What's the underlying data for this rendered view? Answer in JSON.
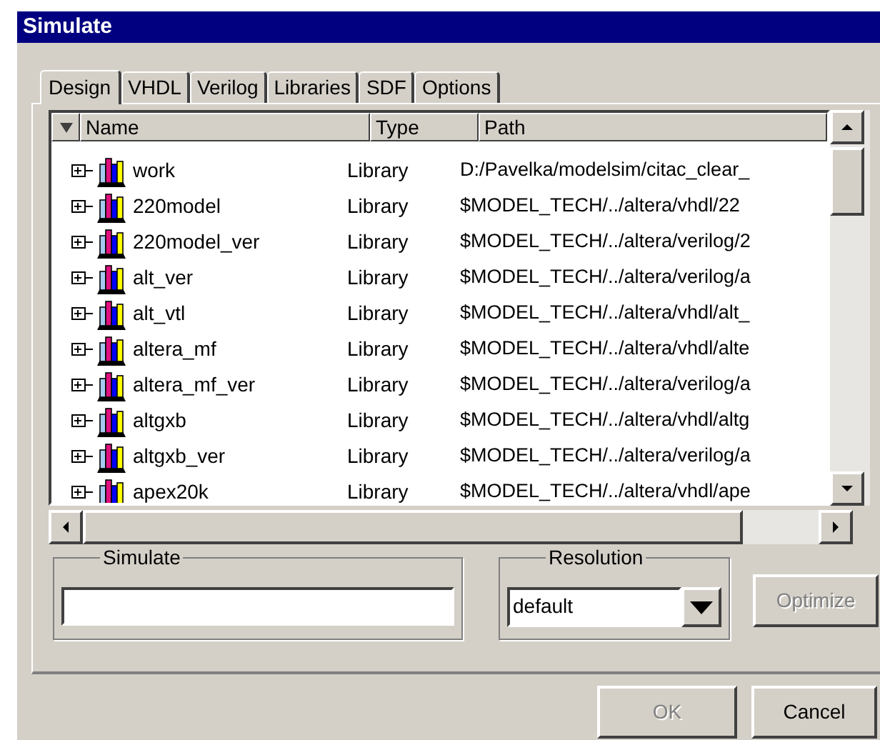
{
  "window": {
    "title": "Simulate"
  },
  "tabs": [
    {
      "label": "Design",
      "selected": true
    },
    {
      "label": "VHDL",
      "selected": false
    },
    {
      "label": "Verilog",
      "selected": false
    },
    {
      "label": "Libraries",
      "selected": false
    },
    {
      "label": "SDF",
      "selected": false
    },
    {
      "label": "Options",
      "selected": false
    }
  ],
  "table": {
    "columns": [
      "Name",
      "Type",
      "Path"
    ],
    "rows": [
      {
        "name": "work",
        "type": "Library",
        "path": "D:/Pavelka/modelsim/citac_clear_",
        "expanded": false
      },
      {
        "name": "220model",
        "type": "Library",
        "path": "$MODEL_TECH/../altera/vhdl/22",
        "expanded": false
      },
      {
        "name": "220model_ver",
        "type": "Library",
        "path": "$MODEL_TECH/../altera/verilog/2",
        "expanded": false
      },
      {
        "name": "alt_ver",
        "type": "Library",
        "path": "$MODEL_TECH/../altera/verilog/a",
        "expanded": false
      },
      {
        "name": "alt_vtl",
        "type": "Library",
        "path": "$MODEL_TECH/../altera/vhdl/alt_",
        "expanded": false
      },
      {
        "name": "altera_mf",
        "type": "Library",
        "path": "$MODEL_TECH/../altera/vhdl/alte",
        "expanded": false
      },
      {
        "name": "altera_mf_ver",
        "type": "Library",
        "path": "$MODEL_TECH/../altera/verilog/a",
        "expanded": false
      },
      {
        "name": "altgxb",
        "type": "Library",
        "path": "$MODEL_TECH/../altera/vhdl/altg",
        "expanded": false
      },
      {
        "name": "altgxb_ver",
        "type": "Library",
        "path": "$MODEL_TECH/../altera/verilog/a",
        "expanded": false
      },
      {
        "name": "apex20k",
        "type": "Library",
        "path": "$MODEL_TECH/../altera/vhdl/ape",
        "expanded": false
      }
    ]
  },
  "simulate": {
    "label": "Simulate"
  },
  "resolution": {
    "label": "Resolution",
    "value": "default"
  },
  "buttons": [
    {
      "label": "Optimize",
      "disabled": true
    },
    {
      "label": "OK",
      "disabled": true
    },
    {
      "label": "Cancel",
      "disabled": false
    }
  ]
}
